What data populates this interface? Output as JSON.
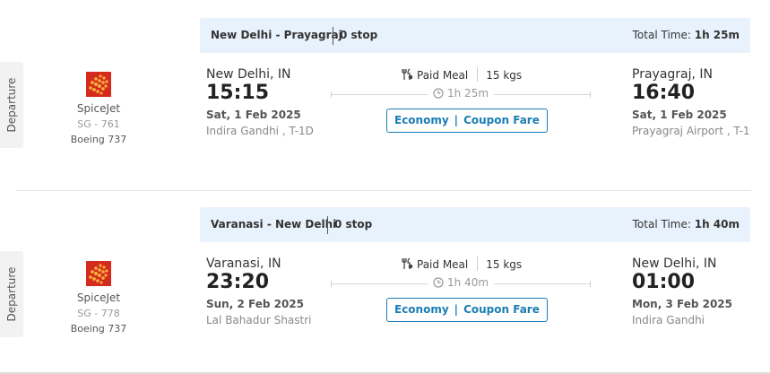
{
  "legs": [
    {
      "tab_label": "Departure",
      "airline": "SpiceJet",
      "flight_no": "SG - 761",
      "aircraft": "Boeing 737",
      "route": "New Delhi - Prayagraj",
      "stops": "0 stop",
      "total_label": "Total Time:",
      "total_time": "1h 25m",
      "dep_city": "New Delhi, IN",
      "dep_time": "15:15",
      "dep_date": "Sat, 1 Feb 2025",
      "dep_airport": "Indira Gandhi , T-1D",
      "meal": "Paid Meal",
      "baggage": "15 kgs",
      "duration": "1h 25m",
      "cabin": "Economy",
      "fare_type": "Coupon Fare",
      "arr_city": "Prayagraj, IN",
      "arr_time": "16:40",
      "arr_date": "Sat, 1 Feb 2025",
      "arr_airport": "Prayagraj Airport , T-1"
    },
    {
      "tab_label": "Departure",
      "airline": "SpiceJet",
      "flight_no": "SG - 778",
      "aircraft": "Boeing 737",
      "route": "Varanasi - New Delhi",
      "stops": "0 stop",
      "total_label": "Total Time:",
      "total_time": "1h 40m",
      "dep_city": "Varanasi, IN",
      "dep_time": "23:20",
      "dep_date": "Sun, 2 Feb 2025",
      "dep_airport": "Lal Bahadur Shastri",
      "meal": "Paid Meal",
      "baggage": "15 kgs",
      "duration": "1h 40m",
      "cabin": "Economy",
      "fare_type": "Coupon Fare",
      "arr_city": "New Delhi, IN",
      "arr_time": "01:00",
      "arr_date": "Mon, 3 Feb 2025",
      "arr_airport": "Indira Gandhi"
    }
  ],
  "icons": {
    "airline_logo": "spicejet-logo",
    "meal": "meal-icon",
    "duration": "clock-icon"
  },
  "colors": {
    "header_bg": "#e8f2fc",
    "fare_accent": "#1a7db5",
    "logo_red": "#d52b1e"
  }
}
